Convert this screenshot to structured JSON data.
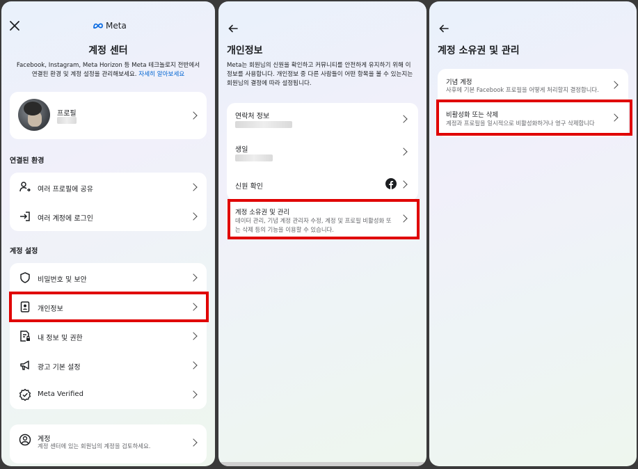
{
  "panel1": {
    "logo_text": "Meta",
    "title": "계정 센터",
    "description": "Facebook, Instagram, Meta Horizon 등 Meta 테크놀로지 전반에서 연결된 환경 및 계정 설정을 관리해보세요.",
    "learn_more": "자세히 알아보세요",
    "profile": {
      "label": "프로필"
    },
    "connected_section": "연결된 환경",
    "connected_items": [
      {
        "label": "여러 프로필에 공유",
        "icon": "share-profiles-icon"
      },
      {
        "label": "여러 계정에 로그인",
        "icon": "login-icon"
      }
    ],
    "settings_section": "계정 설정",
    "settings_items": [
      {
        "label": "비밀번호 및 보안",
        "icon": "shield-icon"
      },
      {
        "label": "개인정보",
        "icon": "id-card-icon"
      },
      {
        "label": "내 정보 및 권한",
        "icon": "document-lock-icon"
      },
      {
        "label": "광고 기본 설정",
        "icon": "megaphone-icon"
      },
      {
        "label": "Meta Verified",
        "icon": "verified-badge-icon"
      }
    ],
    "account": {
      "title": "계정",
      "subtitle": "계정 센터에 있는 회원님의 계정을 검토하세요."
    }
  },
  "panel2": {
    "title": "개인정보",
    "description": "Meta는 회원님의 신원을 확인하고 커뮤니티를 안전하게 유지하기 위해 이 정보를 사용합니다. 개인정보 중 다른 사람들이 어떤 항목을 볼 수 있는지는 회원님의 결정에 따라 설정됩니다.",
    "items": [
      {
        "label": "연락처 정보"
      },
      {
        "label": "생일"
      },
      {
        "label": "신원 확인"
      }
    ],
    "ownership": {
      "title": "계정 소유권 및 관리",
      "subtitle": "데이터 관리, 기념 계정 관리자 수정, 계정 및 프로필 비활성화 또는 삭제 등의 기능을 이용할 수 있습니다."
    }
  },
  "panel3": {
    "title": "계정 소유권 및 관리",
    "items": [
      {
        "title": "기념 계정",
        "subtitle": "사후에 기본 Facebook 프로필을 어떻게 처리할지 결정합니다."
      },
      {
        "title": "비활성화 또는 삭제",
        "subtitle": "계정과 프로필을 일시적으로 비활성화하거나 영구 삭제합니다"
      }
    ]
  },
  "colors": {
    "highlight": "#e00000",
    "link": "#0064d1",
    "facebook": "#1877f2"
  }
}
